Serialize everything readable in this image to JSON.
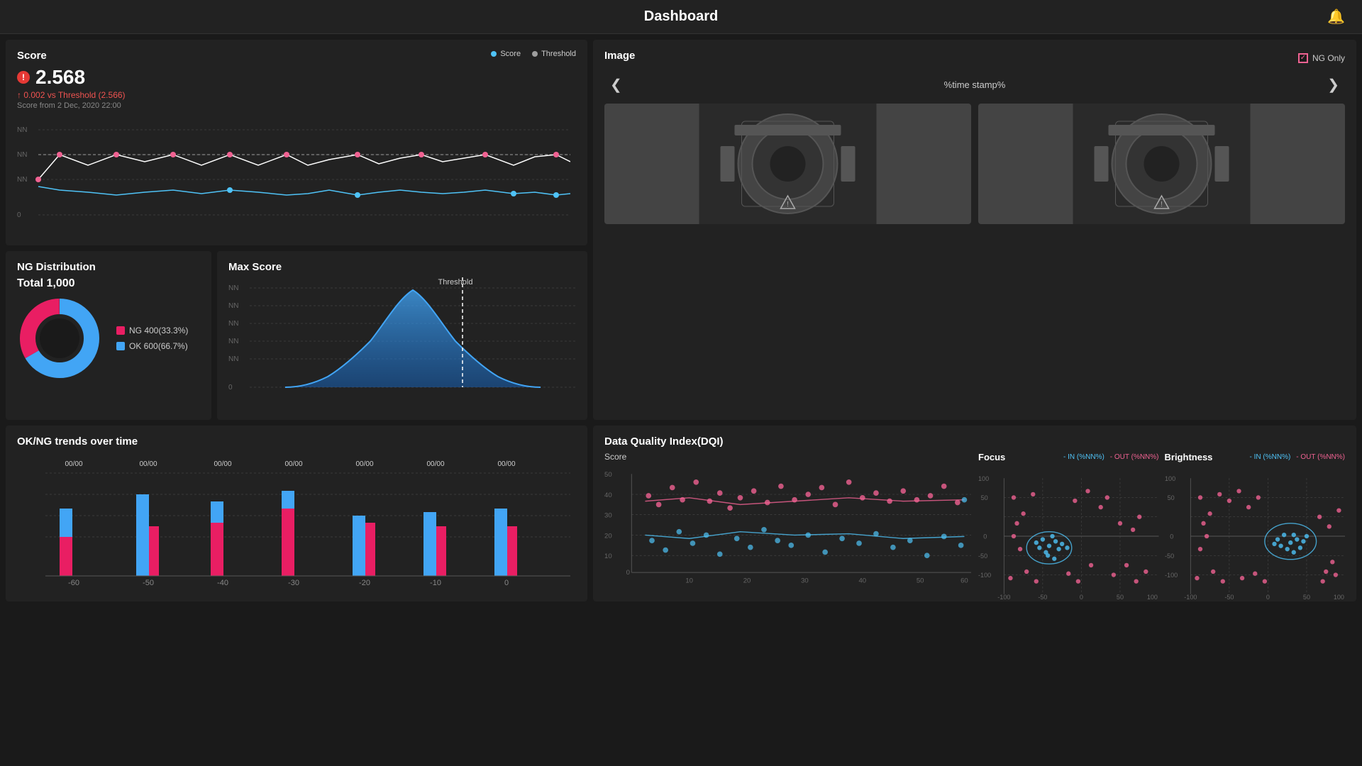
{
  "header": {
    "title": "Dashboard",
    "bell_icon": "🔔"
  },
  "score_panel": {
    "title": "Score",
    "value": "2.568",
    "delta_label": "↑ 0.002 vs Threshold (2.566)",
    "date_label": "Score from 2 Dec, 2020 22:00",
    "legend_score": "Score",
    "legend_threshold": "Threshold",
    "y_labels": [
      "NN",
      "NN",
      "NN",
      "0"
    ],
    "score_color": "#4fc3f7",
    "threshold_color": "#9e9e9e"
  },
  "image_panel": {
    "title": "Image",
    "ng_only_label": "NG Only",
    "timestamp": "%time stamp%",
    "prev_arrow": "❮",
    "next_arrow": "❯"
  },
  "ng_dist_panel": {
    "title": "NG Distribution",
    "total_label": "Total 1,000",
    "ng_value": "400",
    "ng_pct": "33.3%",
    "ok_value": "600",
    "ok_pct": "66.7%",
    "ng_label": "NG 400(33.3%)",
    "ok_label": "OK 600(66.7%)",
    "ng_color": "#e91e63",
    "ok_color": "#42a5f5"
  },
  "max_score_panel": {
    "title": "Max Score",
    "threshold_label": "Threshold",
    "y_labels": [
      "NN",
      "NN",
      "NN",
      "NN",
      "NN",
      "0"
    ],
    "curve_color_top": "#42a5f5",
    "curve_color_bottom": "#1565c0"
  },
  "trend_panel": {
    "title": "OK/NG trends over time",
    "x_labels": [
      "-60",
      "-50",
      "-40",
      "-30",
      "-20",
      "-10",
      "0"
    ],
    "bar_labels": [
      "00/00",
      "00/00",
      "00/00",
      "00/00",
      "00/00",
      "00/00",
      "00/00"
    ],
    "ok_color": "#42a5f5",
    "ng_color": "#e91e63"
  },
  "dqi_panel": {
    "title": "Data Quality Index(DQI)",
    "score_label": "Score",
    "y_max": 50,
    "y_labels": [
      "50",
      "40",
      "30",
      "20",
      "10",
      "0"
    ],
    "x_labels": [
      "10",
      "20",
      "30",
      "40",
      "50",
      "60"
    ],
    "line1_color": "#f06292",
    "line2_color": "#4fc3f7"
  },
  "focus_panel": {
    "title": "Focus",
    "in_label": "IN (%NN%)",
    "out_label": "OUT (%NN%)",
    "in_color": "#4fc3f7",
    "out_color": "#f06292",
    "y_labels": [
      "100",
      "50",
      "0",
      "-50",
      "-100"
    ],
    "x_labels": [
      "-100",
      "-50",
      "0",
      "50",
      "100"
    ]
  },
  "brightness_panel": {
    "title": "Brightness",
    "in_label": "IN (%NN%)",
    "out_label": "OUT (%NN%)",
    "in_color": "#4fc3f7",
    "out_color": "#f06292",
    "y_labels": [
      "100",
      "50",
      "0",
      "-50",
      "-100"
    ],
    "x_labels": [
      "-100",
      "-50",
      "0",
      "50",
      "100"
    ]
  }
}
